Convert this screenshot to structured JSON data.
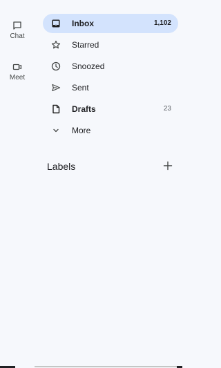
{
  "rail": {
    "chat": {
      "label": "Chat",
      "icon": "chat-icon"
    },
    "meet": {
      "label": "Meet",
      "icon": "video-camera-icon"
    }
  },
  "nav": [
    {
      "label": "Inbox",
      "count": "1,102",
      "icon": "inbox-icon",
      "active": true,
      "bold": true
    },
    {
      "label": "Starred",
      "count": "",
      "icon": "star-icon",
      "active": false,
      "bold": false
    },
    {
      "label": "Snoozed",
      "count": "",
      "icon": "clock-icon",
      "active": false,
      "bold": false
    },
    {
      "label": "Sent",
      "count": "",
      "icon": "send-icon",
      "active": false,
      "bold": false
    },
    {
      "label": "Drafts",
      "count": "23",
      "icon": "draft-icon",
      "active": false,
      "bold": true
    },
    {
      "label": "More",
      "count": "",
      "icon": "chevron-down-icon",
      "active": false,
      "bold": false
    }
  ],
  "labels": {
    "title": "Labels",
    "add_icon": "plus-icon"
  },
  "colors": {
    "active_bg": "#d3e3fd",
    "background": "#f6f8fc"
  }
}
